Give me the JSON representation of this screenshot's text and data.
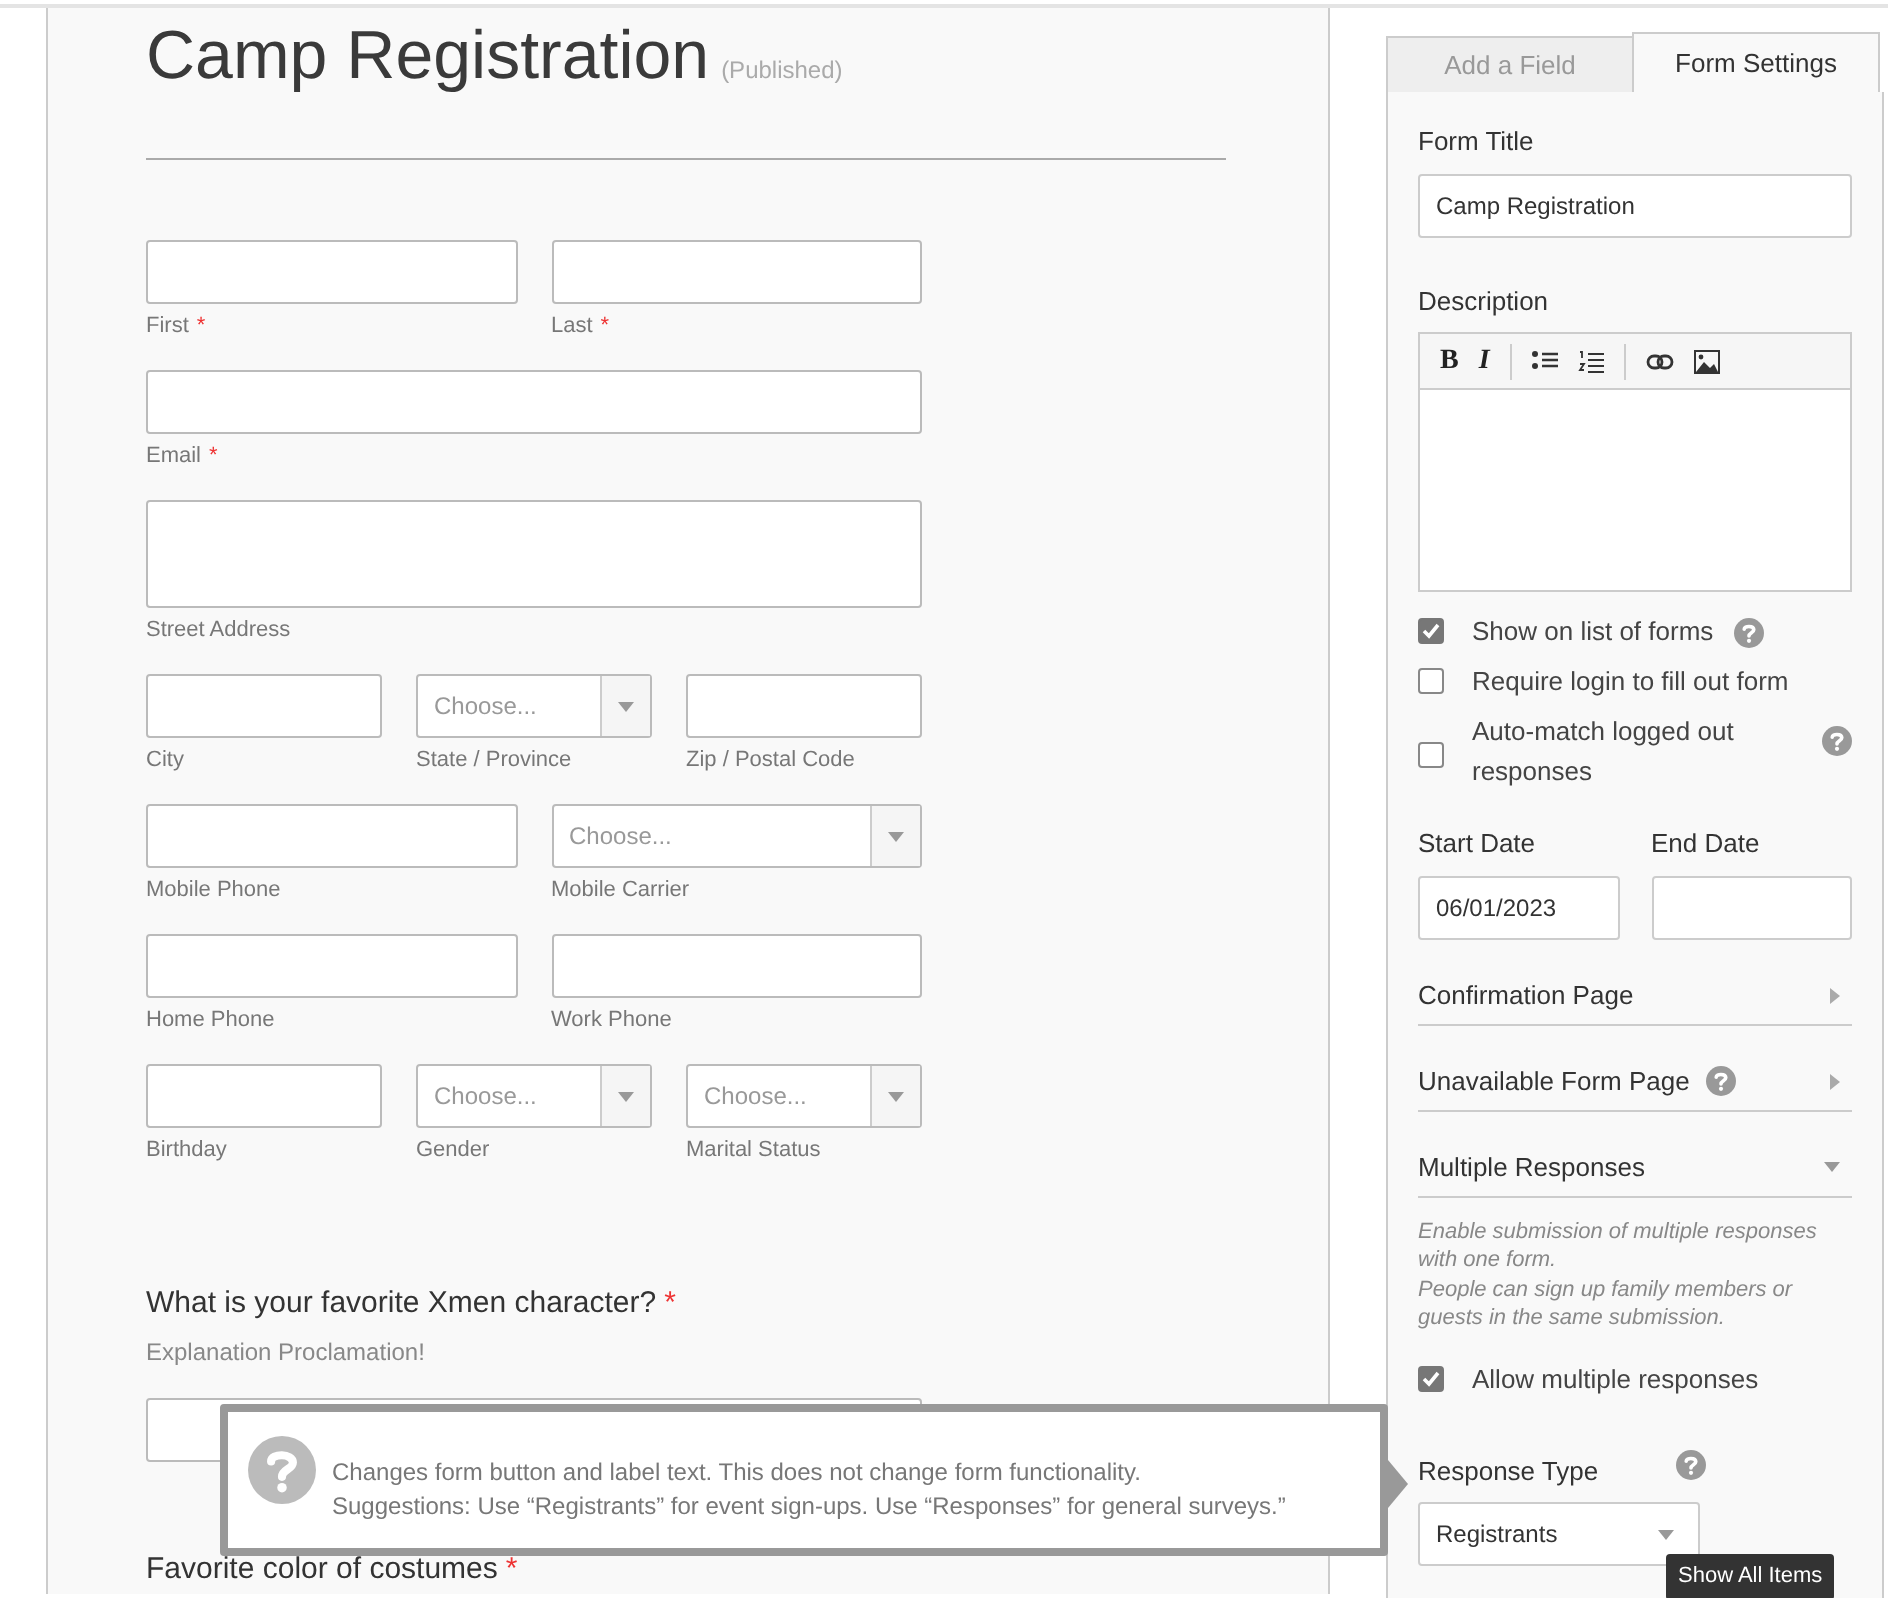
{
  "form": {
    "title": "Camp Registration",
    "status": "(Published)",
    "rows": [
      [
        {
          "kind": "text",
          "label": "First",
          "required_mark": "*"
        },
        {
          "kind": "text",
          "label": "Last",
          "required_mark": "*"
        }
      ],
      [
        {
          "kind": "text",
          "label": "Email",
          "required_mark": "*"
        }
      ],
      [
        {
          "kind": "textarea",
          "label": "Street Address"
        }
      ],
      [
        {
          "kind": "text",
          "label": "City"
        },
        {
          "kind": "select",
          "label": "State / Province",
          "placeholder": "Choose..."
        },
        {
          "kind": "text",
          "label": "Zip / Postal Code"
        }
      ],
      [
        {
          "kind": "text",
          "label": "Mobile Phone"
        },
        {
          "kind": "select",
          "label": "Mobile Carrier",
          "placeholder": "Choose..."
        }
      ],
      [
        {
          "kind": "text",
          "label": "Home Phone"
        },
        {
          "kind": "text",
          "label": "Work Phone"
        }
      ],
      [
        {
          "kind": "text",
          "label": "Birthday"
        },
        {
          "kind": "select",
          "label": "Gender",
          "placeholder": "Choose..."
        },
        {
          "kind": "select",
          "label": "Marital Status",
          "placeholder": "Choose..."
        }
      ]
    ],
    "questions": [
      {
        "label": "What is your favorite Xmen character?",
        "required_mark": "*",
        "help": "Explanation Proclamation!",
        "kind": "text"
      },
      {
        "label": "Favorite color of costumes",
        "required_mark": "*"
      }
    ]
  },
  "settings": {
    "tabs": [
      {
        "label": "Add a Field",
        "selected": false
      },
      {
        "label": "Form Settings",
        "selected": true
      }
    ],
    "form_title": {
      "label": "Form Title",
      "value": "Camp Registration"
    },
    "description": {
      "label": "Description",
      "toolbar": [
        "B",
        "I"
      ]
    },
    "options": [
      {
        "label": "Show on list of forms",
        "checked": true,
        "help": true
      },
      {
        "label": "Require login to fill out form",
        "checked": false,
        "help": false
      },
      {
        "label": "Auto-match logged out responses",
        "checked": false,
        "help": true
      }
    ],
    "start_date": {
      "label": "Start Date",
      "value": "06/01/2023"
    },
    "end_date": {
      "label": "End Date"
    },
    "sections": [
      {
        "label": "Confirmation Page",
        "help": false,
        "expanded": false
      },
      {
        "label": "Unavailable Form Page",
        "help": true,
        "expanded": false
      },
      {
        "label": "Multiple Responses",
        "help": false,
        "expanded": true
      }
    ],
    "note": [
      "Enable submission of multiple responses with one form.",
      "People can sign up family members or guests in the same submission."
    ],
    "allow": {
      "label": "Allow multiple responses",
      "checked": true
    },
    "response_type": {
      "label": "Response Type",
      "value": "Registrants",
      "help": true
    }
  },
  "tooltip": {
    "lines": [
      "Changes form button and label text. This does not change form functionality.",
      "Suggestions: Use “Registrants” for event sign-ups. Use “Responses” for general surveys.”"
    ]
  },
  "hover_tip": "Show All Items"
}
